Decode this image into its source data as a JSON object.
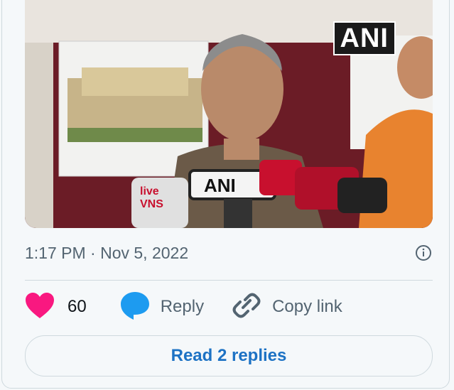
{
  "media": {
    "watermark": "ANI",
    "mic_labels": {
      "ani": "ANI",
      "live_top": "live",
      "live_bottom": "VNS"
    }
  },
  "tweet": {
    "timestamp": "1:17 PM · Nov 5, 2022"
  },
  "actions": {
    "like_count": "60",
    "reply_label": "Reply",
    "copy_link_label": "Copy link"
  },
  "footer": {
    "read_replies_label": "Read 2 replies"
  },
  "colors": {
    "like": "#f91880",
    "reply": "#1d9bf0",
    "link_text": "#1d72c4",
    "secondary_text": "#536471"
  },
  "icons": [
    "heart-icon",
    "speech-bubble-icon",
    "link-icon",
    "info-icon"
  ]
}
